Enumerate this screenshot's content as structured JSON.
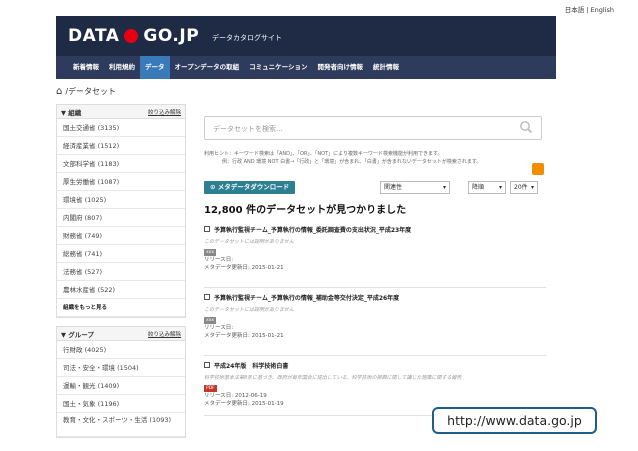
{
  "lang": {
    "ja": "日本語",
    "sep": " | ",
    "en": "English"
  },
  "header": {
    "logo_left": "DATA",
    "logo_right": "GO.JP",
    "subtitle": "データカタログサイト",
    "logo_dot_color": "#e60012",
    "bg_color": "#1f2a44"
  },
  "nav": {
    "items": [
      "新着情報",
      "利用規約",
      "データ",
      "オープンデータの取組",
      "コミュニケーション",
      "開発者向け情報",
      "統計情報"
    ],
    "active_index": 2
  },
  "breadcrumb": {
    "home_icon": "home-icon",
    "sep": " / ",
    "label": "データセット"
  },
  "sidebar": {
    "orgs": {
      "title": "▼ 組織",
      "refine": "絞り込み解除",
      "items": [
        "国土交通省 (3135)",
        "経済産業省 (1512)",
        "文部科学省 (1183)",
        "厚生労働省 (1087)",
        "環境省 (1025)",
        "内閣府 (807)",
        "財務省 (749)",
        "総務省 (741)",
        "法務省 (527)",
        "農林水産省 (522)"
      ],
      "more": "組織をもっと見る"
    },
    "groups": {
      "title": "▼ グループ",
      "refine": "絞り込み解除",
      "items": [
        "行財政 (4025)",
        "司法・安全・環境 (1504)",
        "運輸・観光 (1409)",
        "国土・気象 (1196)",
        "教育・文化・スポーツ・生活 (1093)"
      ]
    }
  },
  "search": {
    "placeholder": "データセットを検索...",
    "icon": "search-icon"
  },
  "hint": {
    "line1": "利用ヒント：キーワード検索は「AND」、「OR」、「NOT」により複数キーワード検索機能が利用できます。",
    "line2": "例：行政 AND 環境 NOT 白書→「行政」と「環境」が含まれ、「白書」が含まれないデータセットが検索されます。"
  },
  "toolbar": {
    "download": "⊙ メタデータダウンロード",
    "sort": "関連性",
    "order": "降順",
    "per_page": "20件"
  },
  "result_count": "12,800 件のデータセットが見つかりました",
  "results": [
    {
      "title": "予算執行監視チーム_予算執行の情報_委託調査費の支出状況_平成23年度",
      "desc": "このデータセットには説明がありません",
      "format": "xxx",
      "format_color": "#888888",
      "line1": "リリース日:",
      "line2": "メタデータ更新日: 2015-01-21"
    },
    {
      "title": "予算執行監視チーム_予算執行の情報_補助金等交付決定_平成26年度",
      "desc": "このデータセットには説明がありません",
      "format": "xxx",
      "format_color": "#888888",
      "line1": "リリース日:",
      "line2": "メタデータ更新日: 2015-01-21"
    },
    {
      "title": "平成24年版　科学技術白書",
      "desc": "科学技術基本法第8条に基づき、政府が毎年国会に提出している、科学技術の振興に関して講じた施策に関する報告",
      "format": "PDF",
      "format_color": "#c0392b",
      "line1": "リリース日: 2012-06-19",
      "line2": "メタデータ更新日: 2015-01-19"
    }
  ],
  "url_label": "http://www.data.go.jp"
}
